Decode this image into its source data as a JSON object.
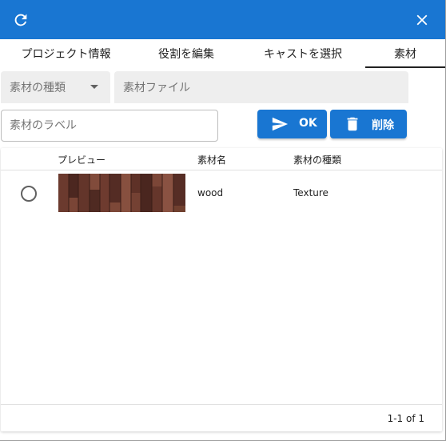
{
  "titlebar": {
    "refresh_icon": "refresh-icon",
    "close_icon": "close-icon",
    "color": "#1976d2"
  },
  "tabs": [
    {
      "label": "プロジェクト情報",
      "active": false
    },
    {
      "label": "役割を編集",
      "active": false
    },
    {
      "label": "キャストを選択",
      "active": false
    },
    {
      "label": "素材",
      "active": true
    }
  ],
  "form": {
    "type_select_placeholder": "素材の種類",
    "file_placeholder": "素材ファイル",
    "label_placeholder": "素材のラベル",
    "label_value": "",
    "ok_label": "OK",
    "delete_label": "削除"
  },
  "table": {
    "columns": [
      "プレビュー",
      "素材名",
      "素材の種類"
    ],
    "rows": [
      {
        "selected": false,
        "preview": "wood-texture-thumbnail",
        "name": "wood",
        "type": "Texture"
      }
    ],
    "pagination": "1-1 of 1"
  }
}
